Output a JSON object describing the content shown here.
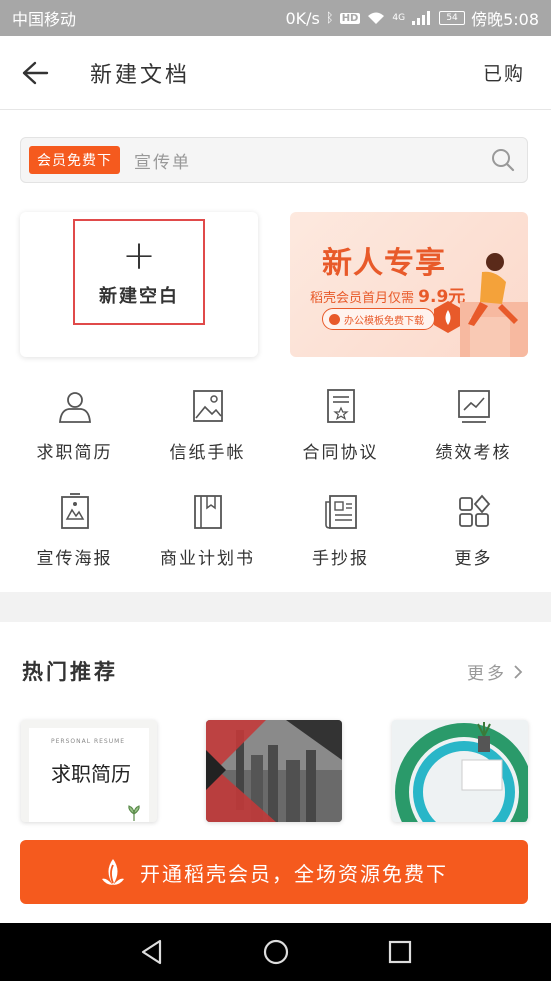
{
  "status_bar": {
    "carrier": "中国移动",
    "speed": "0K/s",
    "hd": "HD",
    "network": "4G",
    "battery": "54",
    "time": "傍晚5:08"
  },
  "header": {
    "title": "新建文档",
    "purchased_label": "已购"
  },
  "search": {
    "member_tag": "会员免费下",
    "placeholder": "宣传单"
  },
  "new_blank": {
    "plus": "+",
    "label": "新建空白"
  },
  "promo": {
    "title": "新人专享",
    "subtitle_prefix": "稻壳会员首月仅需",
    "price": "9.9元",
    "pill": "办公模板免费下载"
  },
  "categories": [
    {
      "label": "求职简历",
      "icon": "person-icon"
    },
    {
      "label": "信纸手帐",
      "icon": "image-icon"
    },
    {
      "label": "合同协议",
      "icon": "contract-icon"
    },
    {
      "label": "绩效考核",
      "icon": "chart-icon"
    },
    {
      "label": "宣传海报",
      "icon": "poster-icon"
    },
    {
      "label": "商业计划书",
      "icon": "book-icon"
    },
    {
      "label": "手抄报",
      "icon": "newspaper-icon"
    },
    {
      "label": "更多",
      "icon": "grid-more-icon"
    }
  ],
  "hot": {
    "title": "热门推荐",
    "more": "更多"
  },
  "thumbs": [
    {
      "heading": "PERSONAL RESUME",
      "big": "求职简历"
    }
  ],
  "cta": {
    "label": "开通稻壳会员，全场资源免费下"
  },
  "colors": {
    "accent": "#f55a1e",
    "highlight_border": "#e04a4a"
  }
}
